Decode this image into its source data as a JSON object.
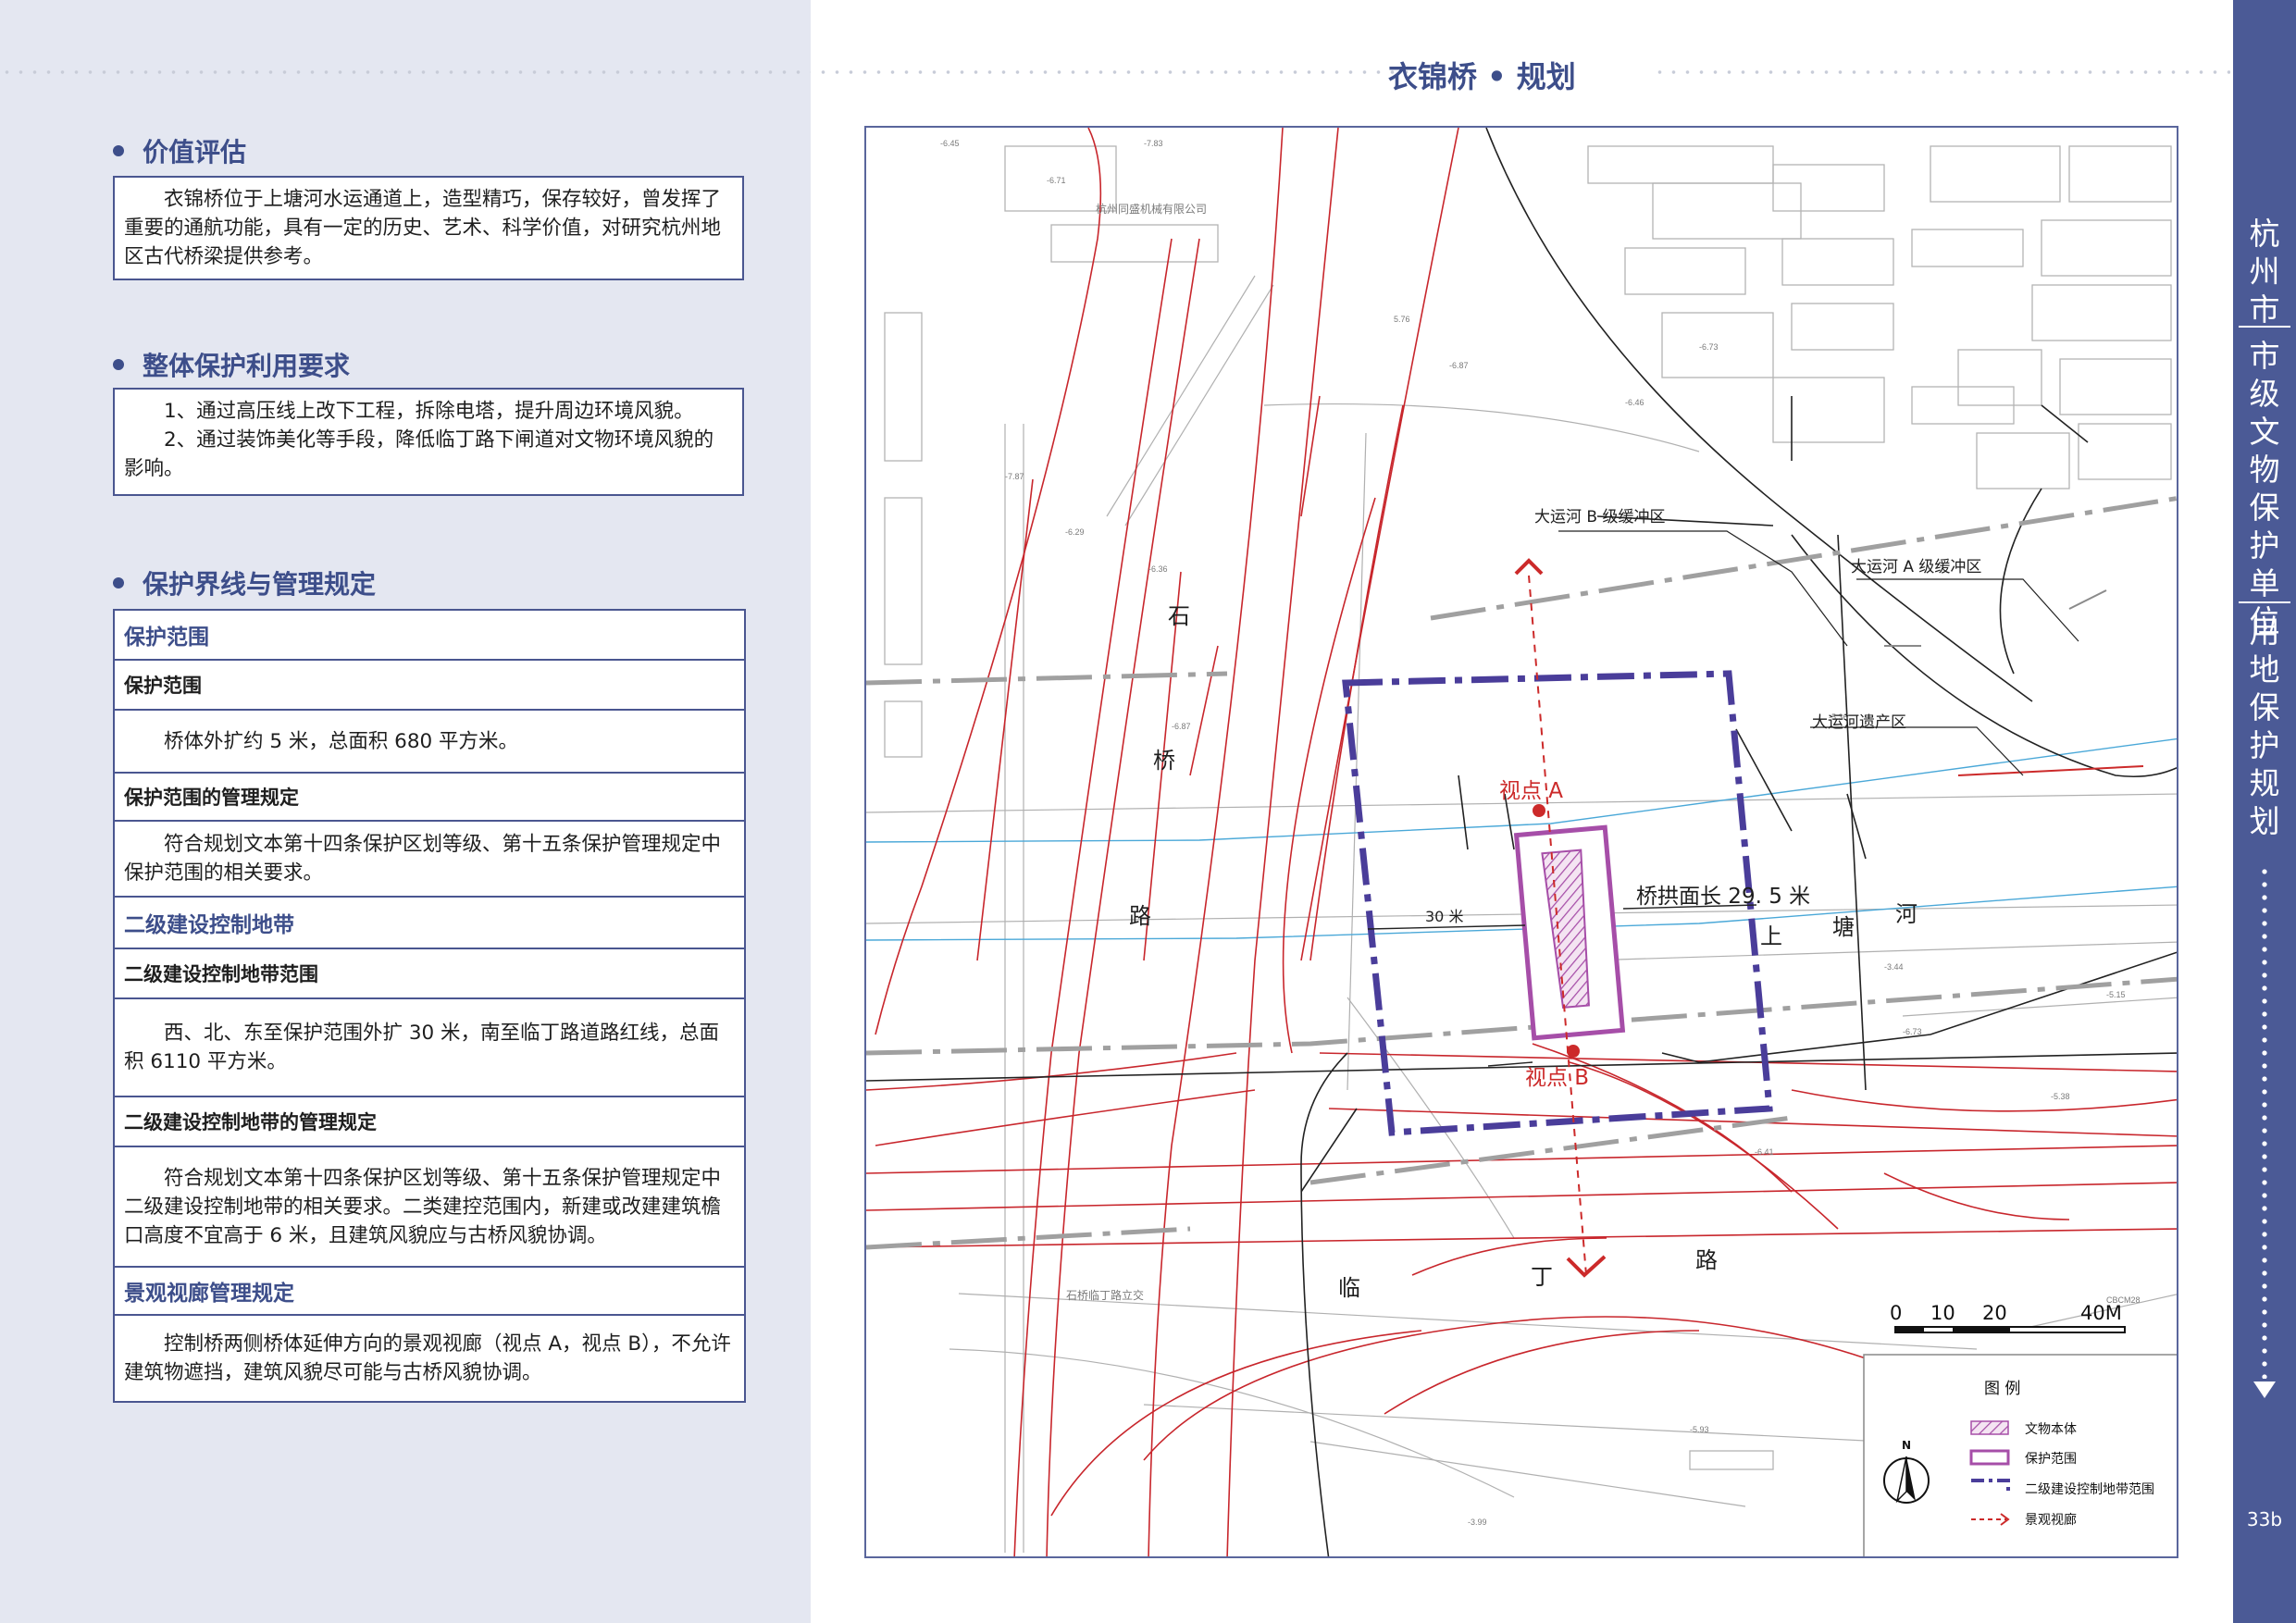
{
  "page": {
    "title": "衣锦桥 • 规划",
    "page_number": "33b"
  },
  "side_tab": {
    "city": "杭州市",
    "category": "市级文物保护单位",
    "chapter": "用地保护规划"
  },
  "sections": {
    "value": {
      "title": "价值评估",
      "text": "衣锦桥位于上塘河水运通道上，造型精巧，保存较好，曾发挥了重要的通航功能，具有一定的历史、艺术、科学价值，对研究杭州地区古代桥梁提供参考。"
    },
    "requirements": {
      "title": "整体保护利用要求",
      "items": [
        "1、通过高压线上改下工程，拆除电塔，提升周边环境风貌。",
        "2、通过装饰美化等手段，降低临丁路下闸道对文物环境风貌的影响。"
      ]
    },
    "boundaries": {
      "title": "保护界线与管理规定",
      "rows": [
        "保护范围",
        "保护范围",
        "桥体外扩约 5 米，总面积 680 平方米。",
        "保护范围的管理规定",
        "符合规划文本第十四条保护区划等级、第十五条保护管理规定中保护范围的相关要求。",
        "二级建设控制地带",
        "二级建设控制地带范围",
        "西、北、东至保护范围外扩 30 米，南至临丁路道路红线，总面积 6110 平方米。",
        "二级建设控制地带的管理规定",
        "符合规划文本第十四条保护区划等级、第十五条保护管理规定中二级建设控制地带的相关要求。二类建控范围内，新建或改建建筑檐口高度不宜高于 6 米，且建筑风貌应与古桥风貌协调。",
        "景观视廊管理规定",
        "控制桥两侧桥体延伸方向的景观视廊（视点 A，视点 B），不允许建筑物遮挡，建筑风貌尽可能与古桥风貌协调。"
      ]
    }
  },
  "map": {
    "roads": {
      "shiqiao": [
        "石",
        "桥",
        "路"
      ],
      "lingding": [
        "临",
        "丁",
        "路"
      ],
      "river": [
        "上",
        "塘",
        "河"
      ]
    },
    "labels": {
      "buffer_b": "大运河 B 级缓冲区",
      "buffer_a": "大运河 A 级缓冲区",
      "heritage": "大运河遗产区",
      "viewpoint_a": "视点 A",
      "viewpoint_b": "视点 B",
      "bridge_length": "桥拱面长 29. 5 米",
      "distance": "30 米"
    },
    "small_labels": [
      "杭州同盛机械有限公司",
      "石桥临丁路立交"
    ],
    "scale": {
      "ticks": [
        "0",
        "10",
        "20",
        "40M"
      ]
    },
    "north": "N",
    "legend": {
      "title": "图   例",
      "items": [
        "文物本体",
        "保护范围",
        "二级建设控制地带范围",
        "景观视廊"
      ]
    },
    "colors": {
      "protect": "#a64ea8",
      "control": "#4a3d9a",
      "view": "#cc2a2a",
      "road": "#c8262c",
      "water": "#4aa8d8"
    }
  }
}
